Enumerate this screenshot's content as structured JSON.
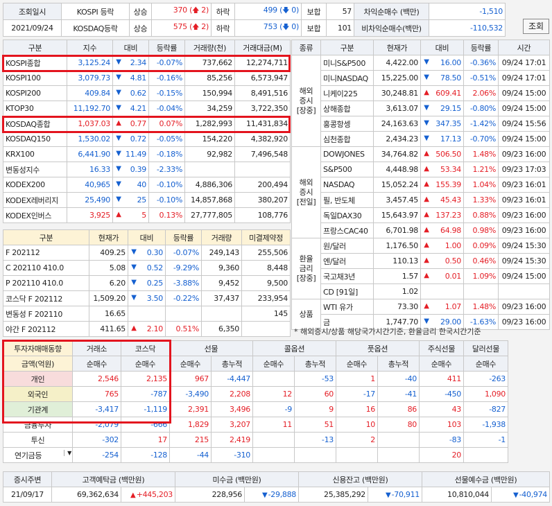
{
  "top": {
    "row1": {
      "label": "조회일시",
      "market": "KOSPI 등락",
      "up_label": "상승",
      "up": "370",
      "up_sub": "2",
      "dn_label": "하락",
      "dn": "499",
      "dn_sub": "0",
      "flat_label": "보합",
      "flat": "57"
    },
    "row2": {
      "date": "2021/09/24",
      "market": "KOSDAQ등락",
      "up_label": "상승",
      "up": "575",
      "up_sub": "2",
      "dn_label": "하락",
      "dn": "753",
      "dn_sub": "0",
      "flat_label": "보합",
      "flat": "101"
    },
    "arb_label": "차익순매수 (백만)",
    "arb": "-1,510",
    "narb_label": "비차익순매수(백만)",
    "narb": "-110,532",
    "button": "조회"
  },
  "idx": {
    "headers": [
      "구분",
      "지수",
      "대비",
      "등락률",
      "거래량(천)",
      "거래대금(M)"
    ],
    "rows": [
      {
        "name": "KOSPI종합",
        "val": "3,125.24",
        "dir": "dn",
        "chg": "2.34",
        "pct": "-0.07%",
        "vol": "737,662",
        "amt": "12,274,711"
      },
      {
        "name": "KOSPI100",
        "val": "3,079.73",
        "dir": "dn",
        "chg": "4.81",
        "pct": "-0.16%",
        "vol": "85,256",
        "amt": "6,573,947"
      },
      {
        "name": "KOSPI200",
        "val": "409.84",
        "dir": "dn",
        "chg": "0.62",
        "pct": "-0.15%",
        "vol": "150,994",
        "amt": "8,491,516"
      },
      {
        "name": "KTOP30",
        "val": "11,192.70",
        "dir": "dn",
        "chg": "4.21",
        "pct": "-0.04%",
        "vol": "34,259",
        "amt": "3,722,350"
      },
      {
        "name": "KOSDAQ종합",
        "val": "1,037.03",
        "dir": "up",
        "chg": "0.77",
        "pct": "0.07%",
        "vol": "1,282,993",
        "amt": "11,431,834"
      },
      {
        "name": "KOSDAQ150",
        "val": "1,530.02",
        "dir": "dn",
        "chg": "0.72",
        "pct": "-0.05%",
        "vol": "154,220",
        "amt": "4,382,920"
      },
      {
        "name": "KRX100",
        "val": "6,441.90",
        "dir": "dn",
        "chg": "11.49",
        "pct": "-0.18%",
        "vol": "92,982",
        "amt": "7,496,548"
      },
      {
        "name": "변동성지수",
        "val": "16.33",
        "dir": "dn",
        "chg": "0.39",
        "pct": "-2.33%",
        "vol": "",
        "amt": ""
      },
      {
        "name": "KODEX200",
        "val": "40,965",
        "dir": "dn",
        "chg": "40",
        "pct": "-0.10%",
        "vol": "4,886,306",
        "amt": "200,494"
      },
      {
        "name": "KODEX레버리지",
        "val": "25,490",
        "dir": "dn",
        "chg": "25",
        "pct": "-0.10%",
        "vol": "14,857,868",
        "amt": "380,207"
      },
      {
        "name": "KODEX인버스",
        "val": "3,925",
        "dir": "up",
        "chg": "5",
        "pct": "0.13%",
        "vol": "27,777,805",
        "amt": "108,776"
      }
    ]
  },
  "fx": {
    "headers": [
      "구분",
      "현재가",
      "대비",
      "등락률",
      "거래량",
      "미결제약정"
    ],
    "rows": [
      {
        "name": "F 202112",
        "val": "409.25",
        "dir": "dn",
        "chg": "0.30",
        "pct": "-0.07%",
        "vol": "249,143",
        "oi": "255,506"
      },
      {
        "name": "C 202110 410.0",
        "val": "5.08",
        "dir": "dn",
        "chg": "0.52",
        "pct": "-9.29%",
        "vol": "9,360",
        "oi": "8,448"
      },
      {
        "name": "P 202110 410.0",
        "val": "6.20",
        "dir": "dn",
        "chg": "0.25",
        "pct": "-3.88%",
        "vol": "9,452",
        "oi": "9,500"
      },
      {
        "name": "코스닥 F 202112",
        "val": "1,509.20",
        "dir": "dn",
        "chg": "3.50",
        "pct": "-0.22%",
        "vol": "37,437",
        "oi": "233,954"
      },
      {
        "name": "변동성 F 202110",
        "val": "16.65",
        "dir": "",
        "chg": "",
        "pct": "",
        "vol": "",
        "oi": "145"
      },
      {
        "name": "야간 F 202112",
        "val": "411.65",
        "dir": "up",
        "chg": "2.10",
        "pct": "0.51%",
        "vol": "6,350",
        "oi": ""
      }
    ]
  },
  "gl": {
    "headers": [
      "종류",
      "구분",
      "현재가",
      "대비",
      "등락률",
      "시간"
    ],
    "groups": [
      {
        "label": "해외\n증시\n[장중]",
        "rows": [
          {
            "name": "미니S&P500",
            "val": "4,422.00",
            "dir": "dn",
            "chg": "16.00",
            "pct": "-0.36%",
            "time": "09/24 17:01"
          },
          {
            "name": "미니NASDAQ",
            "val": "15,225.00",
            "dir": "dn",
            "chg": "78.50",
            "pct": "-0.51%",
            "time": "09/24 17:01"
          },
          {
            "name": "니케이225",
            "val": "30,248.81",
            "dir": "up",
            "chg": "609.41",
            "pct": "2.06%",
            "time": "09/24 15:00"
          },
          {
            "name": "상해종합",
            "val": "3,613.07",
            "dir": "dn",
            "chg": "29.15",
            "pct": "-0.80%",
            "time": "09/24 15:00"
          },
          {
            "name": "홍콩항셍",
            "val": "24,163.63",
            "dir": "dn",
            "chg": "347.35",
            "pct": "-1.42%",
            "time": "09/24 15:56"
          },
          {
            "name": "심천종합",
            "val": "2,434.23",
            "dir": "dn",
            "chg": "17.13",
            "pct": "-0.70%",
            "time": "09/24 15:00"
          }
        ]
      },
      {
        "label": "해외\n증시\n[전일]",
        "rows": [
          {
            "name": "DOWJONES",
            "val": "34,764.82",
            "dir": "up",
            "chg": "506.50",
            "pct": "1.48%",
            "time": "09/23 16:00"
          },
          {
            "name": "S&P500",
            "val": "4,448.98",
            "dir": "up",
            "chg": "53.34",
            "pct": "1.21%",
            "time": "09/23 17:03"
          },
          {
            "name": "NASDAQ",
            "val": "15,052.24",
            "dir": "up",
            "chg": "155.39",
            "pct": "1.04%",
            "time": "09/23 16:01"
          },
          {
            "name": "필, 반도체",
            "val": "3,457.45",
            "dir": "up",
            "chg": "45.43",
            "pct": "1.33%",
            "time": "09/23 16:01"
          },
          {
            "name": "독일DAX30",
            "val": "15,643.97",
            "dir": "up",
            "chg": "137.23",
            "pct": "0.88%",
            "time": "09/23 16:00"
          },
          {
            "name": "프랑스CAC40",
            "val": "6,701.98",
            "dir": "up",
            "chg": "64.98",
            "pct": "0.98%",
            "time": "09/23 16:00"
          }
        ]
      },
      {
        "label": "환율\n금리\n[장중]",
        "rows": [
          {
            "name": "원/달러",
            "val": "1,176.50",
            "dir": "up",
            "chg": "1.00",
            "pct": "0.09%",
            "time": "09/24 15:30"
          },
          {
            "name": "엔/달러",
            "val": "110.13",
            "dir": "up",
            "chg": "0.50",
            "pct": "0.46%",
            "time": "09/24 15:30"
          },
          {
            "name": "국고채3년",
            "val": "1.57",
            "dir": "up",
            "chg": "0.01",
            "pct": "1.09%",
            "time": "09/24 15:00"
          },
          {
            "name": "CD [91일]",
            "val": "1.02",
            "dir": "",
            "chg": "",
            "pct": "",
            "time": ""
          }
        ]
      },
      {
        "label": "상품",
        "rows": [
          {
            "name": "WTI 유가",
            "val": "73.30",
            "dir": "up",
            "chg": "1.07",
            "pct": "1.48%",
            "time": "09/23 16:00"
          },
          {
            "name": "금",
            "val": "1,747.70",
            "dir": "dn",
            "chg": "29.00",
            "pct": "-1.63%",
            "time": "09/23 16:00"
          }
        ]
      }
    ],
    "note": "* 해외증시/상품 해당국가시간기준, 환율금리 한국시간기준"
  },
  "inv": {
    "h1": [
      "투자자매매동향",
      "거래소",
      "코스닥",
      "선물",
      "콜옵션",
      "풋옵션",
      "주식선물",
      "달러선물"
    ],
    "h2": [
      "금액(억원)",
      "순매수",
      "순매수",
      "순매수",
      "총누적",
      "순매수",
      "총누적",
      "순매수",
      "총누적",
      "순매수",
      "순매수"
    ],
    "rows": [
      {
        "name": "개인",
        "v": [
          "2,546",
          "2,135",
          "967",
          "-4,447",
          "",
          "-53",
          "1",
          "-40",
          "411",
          "-263"
        ]
      },
      {
        "name": "외국인",
        "v": [
          "765",
          "-787",
          "-3,490",
          "2,208",
          "12",
          "60",
          "-17",
          "-41",
          "-450",
          "1,090"
        ]
      },
      {
        "name": "기관계",
        "v": [
          "-3,417",
          "-1,119",
          "2,391",
          "3,496",
          "-9",
          "9",
          "16",
          "86",
          "43",
          "-827"
        ]
      },
      {
        "name": "금융투자",
        "v": [
          "-2,079",
          "-666",
          "1,829",
          "3,207",
          "11",
          "51",
          "10",
          "80",
          "103",
          "-1,938"
        ]
      },
      {
        "name": "투신",
        "v": [
          "-302",
          "17",
          "215",
          "2,419",
          "",
          "-13",
          "2",
          "",
          "-83",
          "-1"
        ]
      },
      {
        "name": "연기금등",
        "v": [
          "-254",
          "-128",
          "-44",
          "-310",
          "",
          "",
          "",
          "",
          "20",
          ""
        ]
      }
    ]
  },
  "bot": {
    "headers": [
      "증시주변",
      "고객예탁금 (백만원)",
      "미수금 (백만원)",
      "신용잔고 (백만원)",
      "선물예수금 (백만원)"
    ],
    "date": "21/09/17",
    "dep": "69,362,634",
    "dep_chg": "+445,203",
    "mis": "228,956",
    "mis_chg": "-29,888",
    "cred": "25,385,292",
    "cred_chg": "-70,911",
    "fut": "10,810,044",
    "fut_chg": "-40,974"
  },
  "colors": {
    "up": "#e41e26",
    "down": "#1560d0",
    "highlight": "#e3141e"
  }
}
